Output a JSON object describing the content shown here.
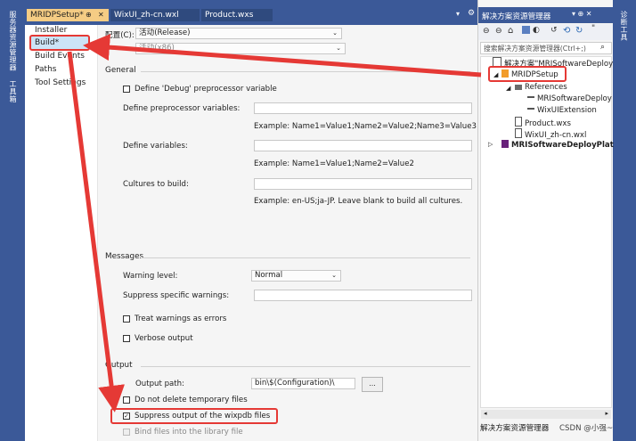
{
  "side_left": {
    "server_explorer": "服务器资源管理器",
    "toolbox": "工具箱"
  },
  "side_right": {
    "diagnostics": "诊断工具"
  },
  "tabs": [
    {
      "label": "MRIDPSetup*",
      "pin": "⊕",
      "close": "✕"
    },
    {
      "label": "WixUI_zh-cn.wxl"
    },
    {
      "label": "Product.wxs"
    }
  ],
  "tab_overflow": "▾",
  "tab_settings": "⚙",
  "nav": [
    "Installer",
    "Build*",
    "Build Events",
    "Paths",
    "Tool Settings"
  ],
  "config": {
    "label": "配置(C):",
    "value": "活动(Release)",
    "platform_value": "活动(x86)"
  },
  "sections": {
    "general": "General",
    "messages": "Messages",
    "output": "Output"
  },
  "general": {
    "define_debug": "Define 'Debug' preprocessor variable",
    "define_pre_label": "Define preprocessor variables:",
    "define_pre_example": "Example: Name1=Value1;Name2=Value2;Name3=Value3",
    "define_vars_label": "Define variables:",
    "define_vars_example": "Example: Name1=Value1;Name2=Value2",
    "cultures_label": "Cultures to build:",
    "cultures_example": "Example: en-US;ja-JP. Leave blank to build all cultures."
  },
  "messages": {
    "warning_level_label": "Warning level:",
    "warning_level_value": "Normal",
    "suppress_warnings_label": "Suppress specific warnings:",
    "treat_warnings": "Treat warnings as errors",
    "verbose": "Verbose output"
  },
  "output": {
    "path_label": "Output path:",
    "path_value": "bin\\$(Configuration)\\",
    "browse": "...",
    "no_delete": "Do not delete temporary files",
    "suppress_wixpdb": "Suppress output of the wixpdb files",
    "bind_files": "Bind files into the library file"
  },
  "solution_explorer": {
    "title": "解决方案资源管理器",
    "title_icons": "▾ ⊕ ✕",
    "search_placeholder": "搜索解决方案资源管理器(Ctrl+;)",
    "search_icon": "⌕",
    "tree": [
      "解决方案\"MRISoftwareDeploy",
      "MRIDPSetup",
      "References",
      "MRISoftwareDeploy",
      "WixUIExtension",
      "Product.wxs",
      "WixUI_zh-cn.wxl",
      "MRISoftwareDeployPlat"
    ],
    "bottom_tab": "解决方案资源管理器"
  },
  "watermark": "CSDN @小强~",
  "colors": {
    "vs_blue": "#3b5998",
    "tab_active": "#f5cc84",
    "highlight_red": "#e53935",
    "nav_selected": "#cce4f7"
  }
}
